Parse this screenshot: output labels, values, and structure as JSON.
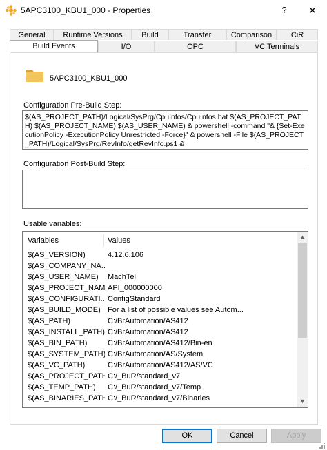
{
  "window": {
    "title": "5APC3100_KBU1_000 - Properties",
    "help_label": "?",
    "close_label": "✕"
  },
  "tabs": {
    "row1": [
      "General",
      "Runtime Versions",
      "Build",
      "Transfer",
      "Comparison",
      "CiR"
    ],
    "row2": [
      "Build Events",
      "I/O",
      "OPC",
      "VC Terminals"
    ],
    "active": "Build Events"
  },
  "object": {
    "name": "5APC3100_KBU1_000",
    "icon": "folder-icon"
  },
  "pre_build": {
    "label": "Configuration Pre-Build Step:",
    "value": "$(AS_PROJECT_PATH)/Logical/SysPrg/CpuInfos/CpuInfos.bat $(AS_PROJECT_PATH) $(AS_PROJECT_NAME) $(AS_USER_NAME) & powershell -command \"& {Set-ExecutionPolicy -ExecutionPolicy Unrestricted -Force}\" & powershell -File $(AS_PROJECT_PATH)/Logical/SysPrg/RevInfo/getRevInfo.ps1 &"
  },
  "post_build": {
    "label": "Configuration Post-Build Step:",
    "value": ""
  },
  "variables": {
    "label": "Usable variables:",
    "columns": [
      "Variables",
      "Values"
    ],
    "rows": [
      [
        "$(AS_VERSION)",
        "4.12.6.106"
      ],
      [
        "$(AS_COMPANY_NA...",
        ""
      ],
      [
        "$(AS_USER_NAME)",
        "MachTel"
      ],
      [
        "$(AS_PROJECT_NAM...",
        "API_000000000"
      ],
      [
        "$(AS_CONFIGURATI...",
        "ConfigStandard"
      ],
      [
        "$(AS_BUILD_MODE)",
        "For a list of possible values see Autom..."
      ],
      [
        "$(AS_PATH)",
        "C:/BrAutomation/AS412"
      ],
      [
        "$(AS_INSTALL_PATH)",
        "C:/BrAutomation/AS412"
      ],
      [
        "$(AS_BIN_PATH)",
        "C:/BrAutomation/AS412/Bin-en"
      ],
      [
        "$(AS_SYSTEM_PATH)",
        "C:/BrAutomation/AS/System"
      ],
      [
        "$(AS_VC_PATH)",
        "C:/BrAutomation/AS412/AS/VC"
      ],
      [
        "$(AS_PROJECT_PATH)",
        "C:/_BuR/standard_v7"
      ],
      [
        "$(AS_TEMP_PATH)",
        "C:/_BuR/standard_v7/Temp"
      ],
      [
        "$(AS_BINARIES_PATH)",
        "C:/_BuR/standard_v7/Binaries"
      ]
    ]
  },
  "buttons": {
    "ok": "OK",
    "cancel": "Cancel",
    "apply": "Apply"
  },
  "colors": {
    "accent": "#0078d7",
    "app_icon": "#f5a623",
    "folder": "#e8b84a"
  }
}
